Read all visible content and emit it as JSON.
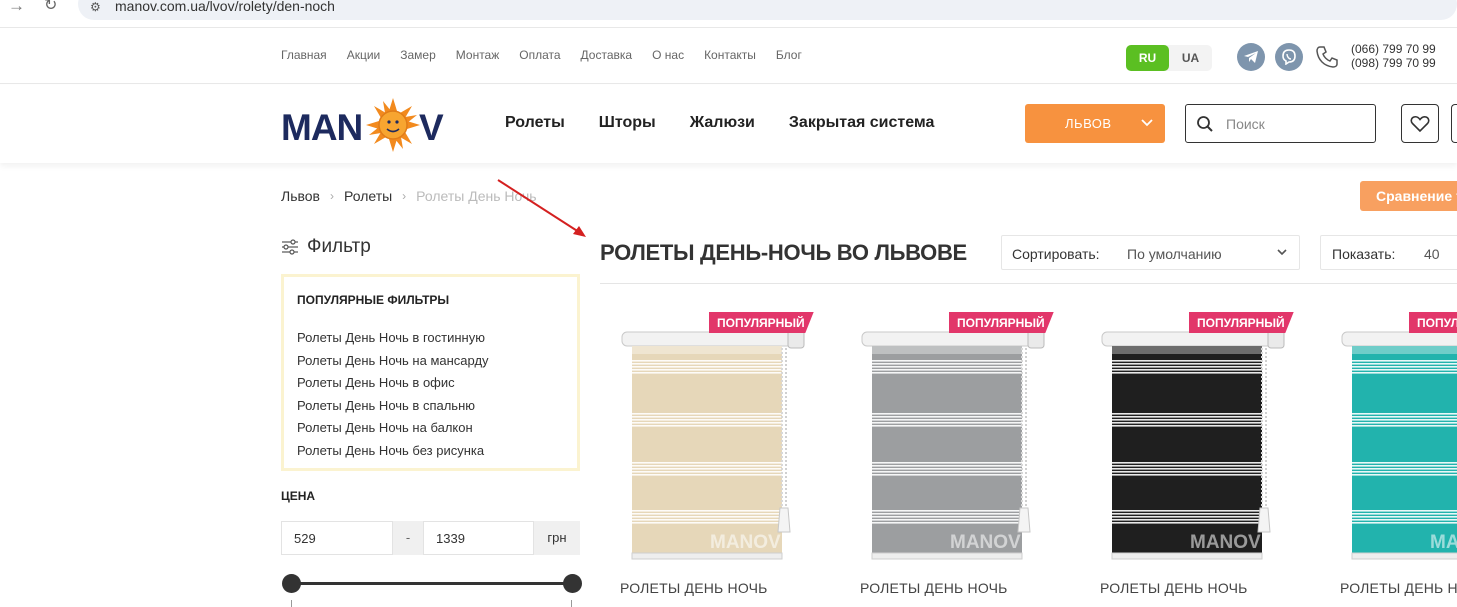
{
  "browser": {
    "url": "manov.com.ua/lvov/rolety/den-noch"
  },
  "topnav": [
    "Главная",
    "Акции",
    "Замер",
    "Монтаж",
    "Оплата",
    "Доставка",
    "О нас",
    "Контакты",
    "Блог"
  ],
  "lang": {
    "active": "RU",
    "other": "UA"
  },
  "phones": [
    "(066) 799 70 99",
    "(098) 799 70 99"
  ],
  "brand": {
    "logo_text": "MANOV",
    "accent": "#f7923f"
  },
  "mainnav": [
    "Ролеты",
    "Шторы",
    "Жалюзи",
    "Закрытая система"
  ],
  "city": {
    "label": "ЛЬВОВ"
  },
  "search": {
    "placeholder": "Поиск"
  },
  "breadcrumbs": [
    "Львов",
    "Ролеты",
    "Ролеты День Ночь"
  ],
  "compare": {
    "label": "Сравнение т"
  },
  "filter": {
    "title": "Фильтр",
    "popular_title": "ПОПУЛЯРНЫЕ ФИЛЬТРЫ",
    "popular": [
      "Ролеты День Ночь в гостинную",
      "Ролеты День Ночь на мансарду",
      "Ролеты День Ночь в офис",
      "Ролеты День Ночь в спальню",
      "Ролеты День Ночь на балкон",
      "Ролеты День Ночь без рисунка"
    ],
    "price_title": "ЦЕНА",
    "price_min": "529",
    "price_dash": "-",
    "price_max": "1339",
    "currency": "грн"
  },
  "catalog": {
    "title": "РОЛЕТЫ ДЕНЬ-НОЧЬ ВО ЛЬВОВЕ",
    "sort_label": "Сортировать:",
    "sort_value": "По умолчанию",
    "show_label": "Показать:",
    "show_value": "40"
  },
  "products": [
    {
      "badge": "ПОПУЛЯРНЫЙ",
      "name": "РОЛЕТЫ ДЕНЬ НОЧЬ",
      "color": "#e6d7b9",
      "watermark": "MANOV"
    },
    {
      "badge": "ПОПУЛЯРНЫЙ",
      "name": "РОЛЕТЫ ДЕНЬ НОЧЬ",
      "color": "#9c9ea0",
      "watermark": "MANOV"
    },
    {
      "badge": "ПОПУЛЯРНЫЙ",
      "name": "РОЛЕТЫ ДЕНЬ НОЧЬ",
      "color": "#1f1f1f",
      "watermark": "MANOV"
    },
    {
      "badge": "ПОПУЛЯРНЫЙ",
      "name": "РОЛЕТЫ ДЕНЬ НОЧЬ",
      "color": "#22b3ad",
      "watermark": "MANOV"
    }
  ]
}
